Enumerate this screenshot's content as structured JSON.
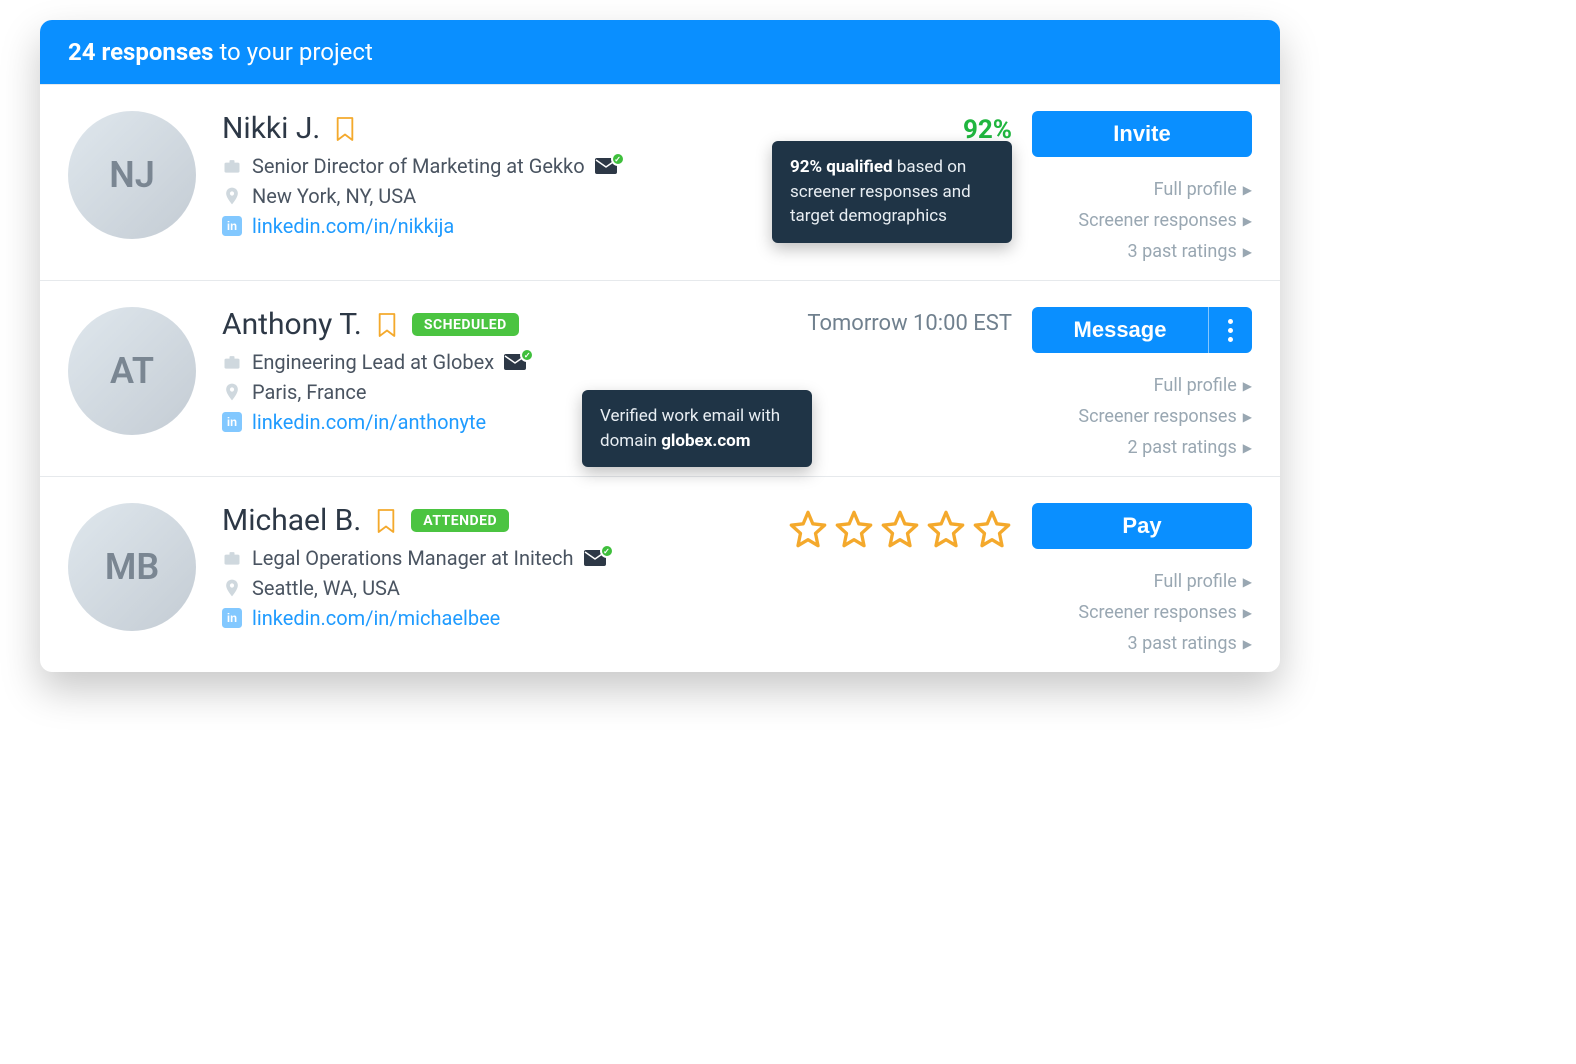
{
  "header": {
    "count": "24 responses",
    "suffix": " to your project"
  },
  "actions_common": {
    "full_profile": "Full profile",
    "screener": "Screener responses"
  },
  "people": [
    {
      "initials": "NJ",
      "name": "Nikki J.",
      "role": "Senior Director of Marketing at Gekko",
      "location": "New York, NY, USA",
      "linkedin": "linkedin.com/in/nikkija",
      "qualification_pct": "92%",
      "tooltip_qual_bold": "92% qualified",
      "tooltip_qual_rest": " based on screener responses and target demographics",
      "primary_btn": "Invite",
      "ratings": "3 past ratings"
    },
    {
      "initials": "AT",
      "name": "Anthony T.",
      "badge": "SCHEDULED",
      "role": "Engineering Lead at Globex",
      "location": "Paris, France",
      "linkedin": "linkedin.com/in/anthonyte",
      "schedule_text": "Tomorrow 10:00 EST",
      "tooltip_verify_pre": "Verified work email with domain ",
      "tooltip_verify_bold": "globex.com",
      "primary_btn": "Message",
      "ratings": "2 past ratings"
    },
    {
      "initials": "MB",
      "name": "Michael B.",
      "badge": "ATTENDED",
      "role": "Legal Operations Manager at Initech",
      "location": "Seattle, WA, USA",
      "linkedin": "linkedin.com/in/michaelbee",
      "stars": 5,
      "primary_btn": "Pay",
      "ratings": "3 past ratings"
    }
  ]
}
